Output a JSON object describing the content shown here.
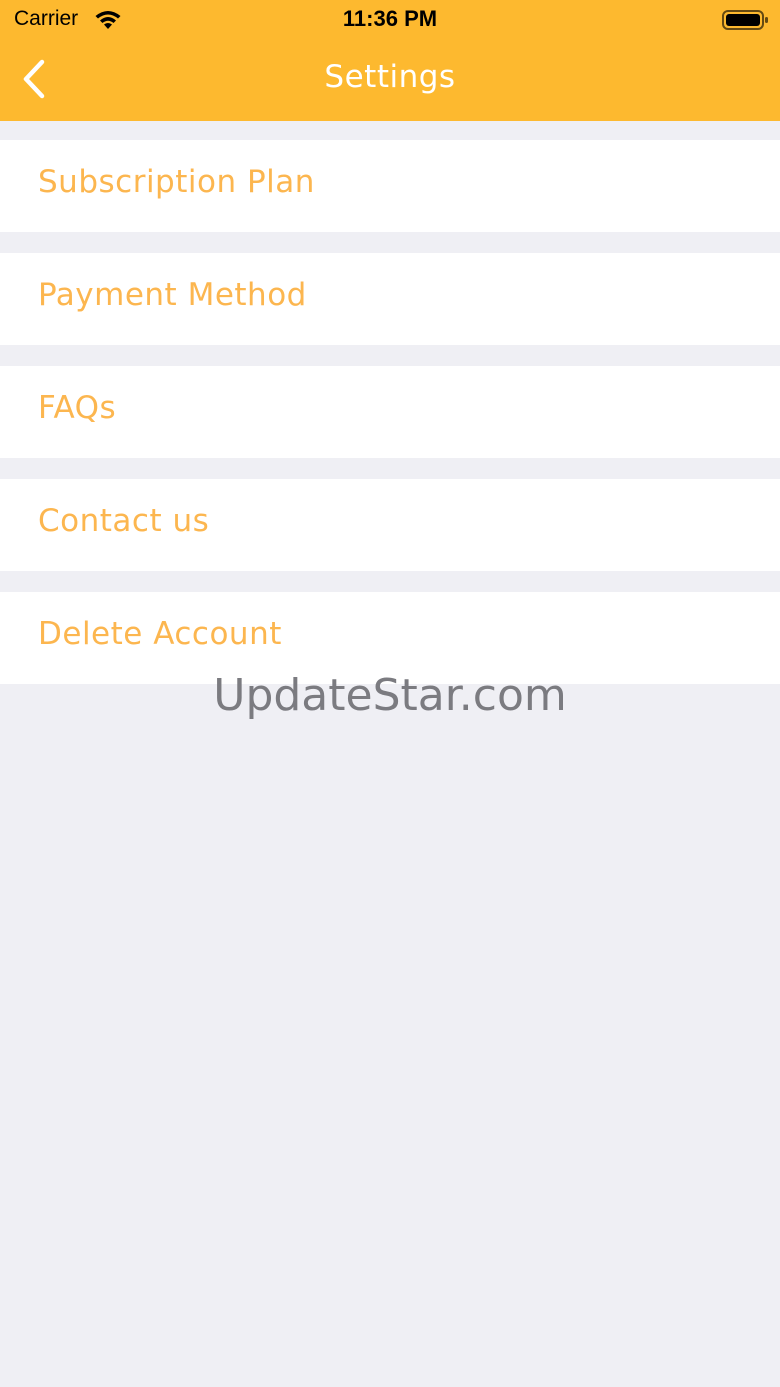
{
  "status_bar": {
    "carrier": "Carrier",
    "time": "11:36 PM"
  },
  "nav": {
    "title": "Settings",
    "back_icon": "chevron-left-icon"
  },
  "menu": {
    "items": [
      {
        "label": "Subscription Plan"
      },
      {
        "label": "Payment Method"
      },
      {
        "label": "FAQs"
      },
      {
        "label": "Contact us"
      },
      {
        "label": "Delete Account"
      }
    ]
  },
  "watermark": "UpdateStar.com",
  "colors": {
    "header": "#fdb92f",
    "menu_text": "#fcb64f",
    "background": "#efeff4"
  }
}
